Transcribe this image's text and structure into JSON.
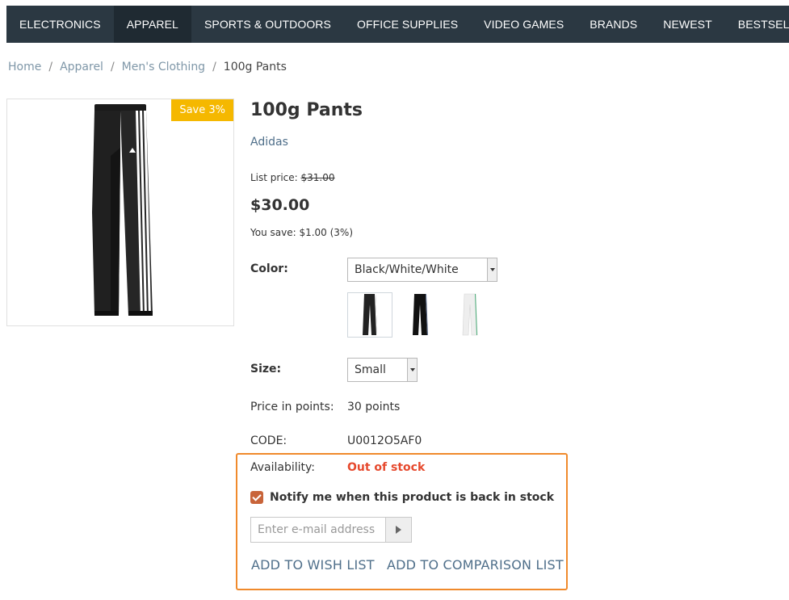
{
  "nav": {
    "items": [
      {
        "label": "ELECTRONICS",
        "active": false
      },
      {
        "label": "APPAREL",
        "active": true
      },
      {
        "label": "SPORTS & OUTDOORS",
        "active": false
      },
      {
        "label": "OFFICE SUPPLIES",
        "active": false
      },
      {
        "label": "VIDEO GAMES",
        "active": false
      },
      {
        "label": "BRANDS",
        "active": false
      },
      {
        "label": "NEWEST",
        "active": false
      },
      {
        "label": "BESTSELLERS",
        "active": false
      }
    ]
  },
  "breadcrumb": {
    "items": [
      "Home",
      "Apparel",
      "Men's Clothing"
    ],
    "current": "100g Pants",
    "separator": "/"
  },
  "product": {
    "save_badge": "Save 3%",
    "title": "100g Pants",
    "brand": "Adidas",
    "list_price_label": "List price:",
    "list_price": "$31.00",
    "price": "$30.00",
    "you_save": "You save: $1.00 (3%)",
    "color_label": "Color:",
    "color_selected": "Black/White/White",
    "swatches": [
      "black-white-pants",
      "black-pants",
      "white-pants"
    ],
    "size_label": "Size:",
    "size_selected": "Small",
    "points_label": "Price in points:",
    "points_value": "30 points",
    "code_label": "CODE:",
    "code_value": "U0012O5AF0",
    "availability_label": "Availability:",
    "availability_value": "Out of stock",
    "notify_label": "Notify me when this product is back in stock",
    "notify_checked": true,
    "email_placeholder": "Enter e-mail address",
    "wish_list_label": "ADD TO WISH LIST",
    "comparison_label": "ADD TO COMPARISON LIST"
  },
  "colors": {
    "nav_bg": "#2b3842",
    "badge": "#f5b800",
    "out_of_stock": "#e6492d",
    "highlight_border": "#f08a2c",
    "link": "#4f6f8a"
  }
}
